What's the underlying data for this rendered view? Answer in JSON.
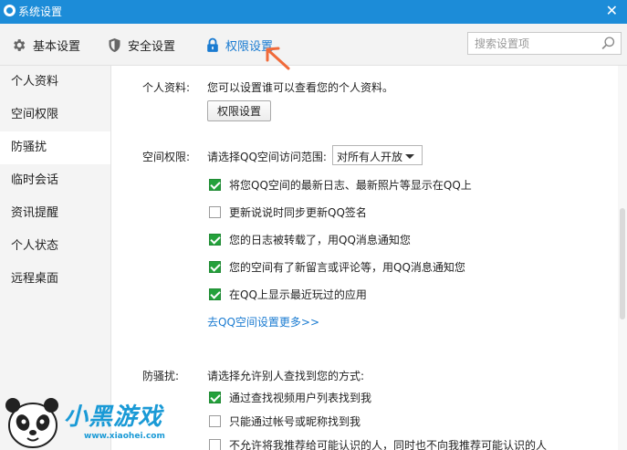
{
  "window": {
    "title": "系统设置",
    "close_glyph": "✕"
  },
  "toolbar": {
    "tabs": [
      {
        "label": "基本设置",
        "icon": "gear-icon"
      },
      {
        "label": "安全设置",
        "icon": "shield-icon"
      },
      {
        "label": "权限设置",
        "icon": "lock-icon",
        "active": true
      }
    ],
    "search_placeholder": "搜索设置项"
  },
  "sidebar": {
    "items": [
      {
        "label": "个人资料"
      },
      {
        "label": "空间权限"
      },
      {
        "label": "防骚扰",
        "active": true
      },
      {
        "label": "临时会话"
      },
      {
        "label": "资讯提醒"
      },
      {
        "label": "个人状态"
      },
      {
        "label": "远程桌面"
      }
    ]
  },
  "main": {
    "profile": {
      "label": "个人资料:",
      "description": "您可以设置谁可以查看您的个人资料。",
      "button": "权限设置"
    },
    "space": {
      "label": "空间权限:",
      "prompt": "请选择QQ空间访问范围:",
      "scope_value": "对所有人开放",
      "options": [
        {
          "label": "将您QQ空间的最新日志、最新照片等显示在QQ上",
          "checked": true
        },
        {
          "label": "更新说说时同步更新QQ签名",
          "checked": false
        },
        {
          "label": "您的日志被转载了，用QQ消息通知您",
          "checked": true
        },
        {
          "label": "您的空间有了新留言或评论等，用QQ消息通知您",
          "checked": true
        },
        {
          "label": "在QQ上显示最近玩过的应用",
          "checked": true
        }
      ],
      "more_link": "去QQ空间设置更多>>"
    },
    "harass": {
      "label": "防骚扰:",
      "prompt": "请选择允许别人查找到您的方式:",
      "options": [
        {
          "label": "通过查找视频用户列表找到我",
          "checked": true
        },
        {
          "label": "只能通过帐号或昵称找到我",
          "checked": false
        },
        {
          "label": "不允许将我推荐给可能认识的人，同时也不向我推荐可能认识的人",
          "checked": false
        }
      ]
    }
  },
  "watermark": {
    "text": "小黑游戏",
    "url": "www.xiaohei.com"
  },
  "colors": {
    "titlebar": "#1c8cd8",
    "accent": "#1a7bd1",
    "check": "#24a13b",
    "arrow": "#f06a3a"
  }
}
